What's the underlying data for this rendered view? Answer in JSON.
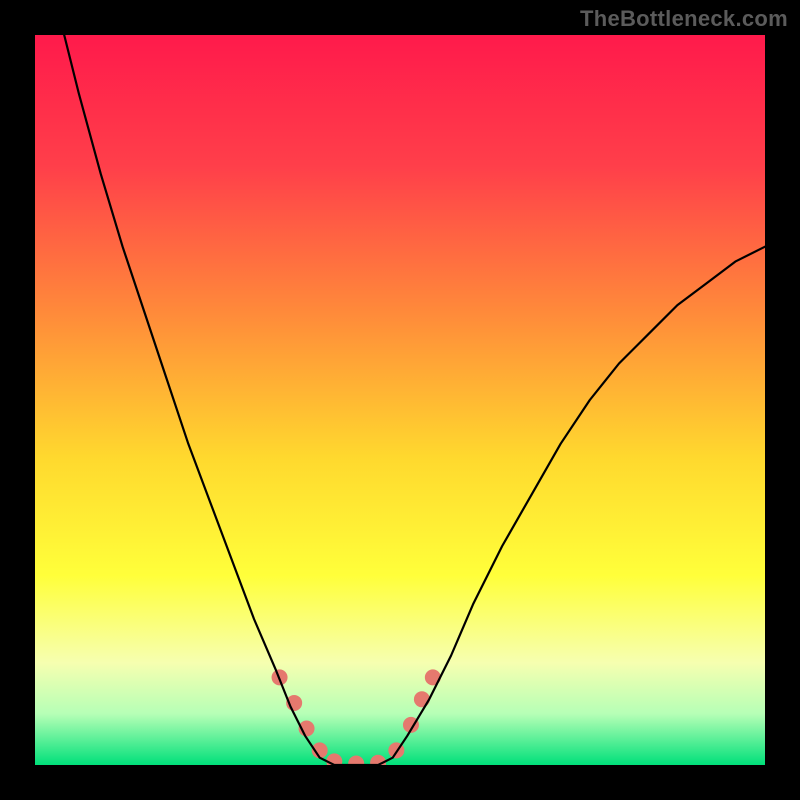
{
  "watermark": "TheBottleneck.com",
  "chart_data": {
    "type": "line",
    "title": "",
    "xlabel": "",
    "ylabel": "",
    "xlim": [
      0,
      100
    ],
    "ylim": [
      0,
      100
    ],
    "background_gradient_stops": [
      {
        "offset": 0.0,
        "color": "#ff1a4b"
      },
      {
        "offset": 0.18,
        "color": "#ff3f4a"
      },
      {
        "offset": 0.38,
        "color": "#ff8a3a"
      },
      {
        "offset": 0.58,
        "color": "#ffd92e"
      },
      {
        "offset": 0.74,
        "color": "#ffff3a"
      },
      {
        "offset": 0.86,
        "color": "#f6ffb0"
      },
      {
        "offset": 0.93,
        "color": "#b6ffb6"
      },
      {
        "offset": 1.0,
        "color": "#00e07a"
      }
    ],
    "series": [
      {
        "name": "bottleneck-curve",
        "stroke": "#000000",
        "stroke_width": 2.2,
        "points": [
          {
            "x": 4.0,
            "y": 100.0
          },
          {
            "x": 6.0,
            "y": 92.0
          },
          {
            "x": 9.0,
            "y": 81.0
          },
          {
            "x": 12.0,
            "y": 71.0
          },
          {
            "x": 15.0,
            "y": 62.0
          },
          {
            "x": 18.0,
            "y": 53.0
          },
          {
            "x": 21.0,
            "y": 44.0
          },
          {
            "x": 24.0,
            "y": 36.0
          },
          {
            "x": 27.0,
            "y": 28.0
          },
          {
            "x": 30.0,
            "y": 20.0
          },
          {
            "x": 33.0,
            "y": 13.0
          },
          {
            "x": 35.0,
            "y": 8.0
          },
          {
            "x": 37.0,
            "y": 4.0
          },
          {
            "x": 39.0,
            "y": 1.0
          },
          {
            "x": 41.0,
            "y": 0.0
          },
          {
            "x": 44.0,
            "y": 0.0
          },
          {
            "x": 47.0,
            "y": 0.0
          },
          {
            "x": 49.0,
            "y": 1.0
          },
          {
            "x": 51.0,
            "y": 4.0
          },
          {
            "x": 54.0,
            "y": 9.0
          },
          {
            "x": 57.0,
            "y": 15.0
          },
          {
            "x": 60.0,
            "y": 22.0
          },
          {
            "x": 64.0,
            "y": 30.0
          },
          {
            "x": 68.0,
            "y": 37.0
          },
          {
            "x": 72.0,
            "y": 44.0
          },
          {
            "x": 76.0,
            "y": 50.0
          },
          {
            "x": 80.0,
            "y": 55.0
          },
          {
            "x": 84.0,
            "y": 59.0
          },
          {
            "x": 88.0,
            "y": 63.0
          },
          {
            "x": 92.0,
            "y": 66.0
          },
          {
            "x": 96.0,
            "y": 69.0
          },
          {
            "x": 100.0,
            "y": 71.0
          }
        ]
      }
    ],
    "markers": {
      "color": "#e5796e",
      "radius": 8,
      "points": [
        {
          "x": 33.5,
          "y": 12.0
        },
        {
          "x": 35.5,
          "y": 8.5
        },
        {
          "x": 37.2,
          "y": 5.0
        },
        {
          "x": 39.0,
          "y": 2.0
        },
        {
          "x": 41.0,
          "y": 0.5
        },
        {
          "x": 44.0,
          "y": 0.2
        },
        {
          "x": 47.0,
          "y": 0.3
        },
        {
          "x": 49.5,
          "y": 2.0
        },
        {
          "x": 51.5,
          "y": 5.5
        },
        {
          "x": 53.0,
          "y": 9.0
        },
        {
          "x": 54.5,
          "y": 12.0
        }
      ]
    }
  }
}
